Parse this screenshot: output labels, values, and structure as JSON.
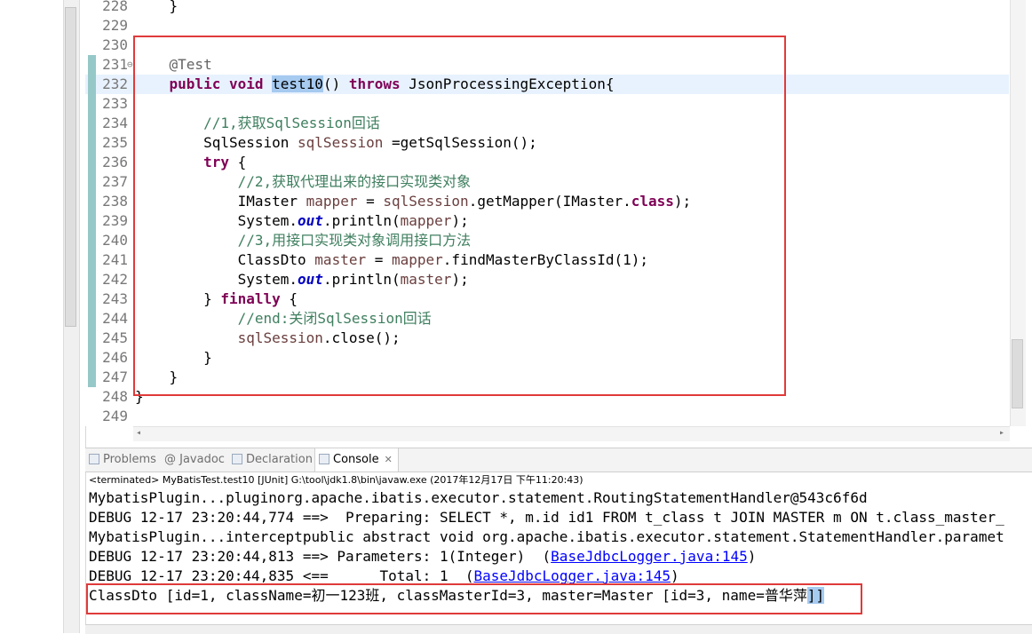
{
  "editor": {
    "lines": [
      {
        "num": "228",
        "segments": [
          {
            "t": "    }",
            "c": ""
          }
        ]
      },
      {
        "num": "229",
        "segments": []
      },
      {
        "num": "230",
        "segments": []
      },
      {
        "num": "231",
        "segments": [
          {
            "t": "    ",
            "c": ""
          },
          {
            "t": "@Test",
            "c": "ann"
          }
        ],
        "fold": "⊖"
      },
      {
        "num": "232",
        "current": true,
        "segments": [
          {
            "t": "    ",
            "c": ""
          },
          {
            "t": "public",
            "c": "kw"
          },
          {
            "t": " ",
            "c": ""
          },
          {
            "t": "void",
            "c": "kw"
          },
          {
            "t": " ",
            "c": ""
          },
          {
            "t": "test10",
            "c": "sel"
          },
          {
            "t": "() ",
            "c": ""
          },
          {
            "t": "throws",
            "c": "kw"
          },
          {
            "t": " JsonProcessingException{",
            "c": ""
          }
        ]
      },
      {
        "num": "233",
        "segments": []
      },
      {
        "num": "234",
        "segments": [
          {
            "t": "        ",
            "c": ""
          },
          {
            "t": "//1,获取SqlSession回话",
            "c": "cmt"
          }
        ]
      },
      {
        "num": "235",
        "segments": [
          {
            "t": "        SqlSession ",
            "c": ""
          },
          {
            "t": "sqlSession",
            "c": "var"
          },
          {
            "t": " =getSqlSession();",
            "c": ""
          }
        ]
      },
      {
        "num": "236",
        "segments": [
          {
            "t": "        ",
            "c": ""
          },
          {
            "t": "try",
            "c": "kw"
          },
          {
            "t": " {",
            "c": ""
          }
        ]
      },
      {
        "num": "237",
        "segments": [
          {
            "t": "            ",
            "c": ""
          },
          {
            "t": "//2,获取代理出来的接口实现类对象",
            "c": "cmt"
          }
        ]
      },
      {
        "num": "238",
        "segments": [
          {
            "t": "            IMaster ",
            "c": ""
          },
          {
            "t": "mapper",
            "c": "var"
          },
          {
            "t": " = ",
            "c": ""
          },
          {
            "t": "sqlSession",
            "c": "var"
          },
          {
            "t": ".getMapper(IMaster.",
            "c": ""
          },
          {
            "t": "class",
            "c": "kw"
          },
          {
            "t": ");",
            "c": ""
          }
        ]
      },
      {
        "num": "239",
        "segments": [
          {
            "t": "            System.",
            "c": ""
          },
          {
            "t": "out",
            "c": "fld"
          },
          {
            "t": ".println(",
            "c": ""
          },
          {
            "t": "mapper",
            "c": "var"
          },
          {
            "t": ");",
            "c": ""
          }
        ]
      },
      {
        "num": "240",
        "segments": [
          {
            "t": "            ",
            "c": ""
          },
          {
            "t": "//3,用接口实现类对象调用接口方法",
            "c": "cmt"
          }
        ]
      },
      {
        "num": "241",
        "segments": [
          {
            "t": "            ClassDto ",
            "c": ""
          },
          {
            "t": "master",
            "c": "var"
          },
          {
            "t": " = ",
            "c": ""
          },
          {
            "t": "mapper",
            "c": "var"
          },
          {
            "t": ".findMasterByClassId(1);",
            "c": ""
          }
        ]
      },
      {
        "num": "242",
        "segments": [
          {
            "t": "            System.",
            "c": ""
          },
          {
            "t": "out",
            "c": "fld"
          },
          {
            "t": ".println(",
            "c": ""
          },
          {
            "t": "master",
            "c": "var"
          },
          {
            "t": ");",
            "c": ""
          }
        ]
      },
      {
        "num": "243",
        "segments": [
          {
            "t": "        } ",
            "c": ""
          },
          {
            "t": "finally",
            "c": "kw"
          },
          {
            "t": " {",
            "c": ""
          }
        ]
      },
      {
        "num": "244",
        "segments": [
          {
            "t": "            ",
            "c": ""
          },
          {
            "t": "//end:关闭SqlSession回话",
            "c": "cmt"
          }
        ]
      },
      {
        "num": "245",
        "segments": [
          {
            "t": "            ",
            "c": ""
          },
          {
            "t": "sqlSession",
            "c": "var"
          },
          {
            "t": ".close();",
            "c": ""
          }
        ]
      },
      {
        "num": "246",
        "segments": [
          {
            "t": "        }",
            "c": ""
          }
        ]
      },
      {
        "num": "247",
        "segments": [
          {
            "t": "    }",
            "c": ""
          }
        ]
      },
      {
        "num": "248",
        "segments": [
          {
            "t": "}",
            "c": ""
          }
        ]
      },
      {
        "num": "249",
        "segments": []
      }
    ]
  },
  "tabs": [
    {
      "label": "Problems",
      "active": false
    },
    {
      "label": "@ Javadoc",
      "active": false
    },
    {
      "label": "Declaration",
      "active": false
    },
    {
      "label": "Console",
      "active": true
    }
  ],
  "console": {
    "status": "<terminated> MyBatisTest.test10 [JUnit] G:\\tool\\jdk1.8\\bin\\javaw.exe (2017年12月17日 下午11:20:43)",
    "lines": [
      {
        "segments": [
          {
            "t": "MybatisPlugin...pluginorg.apache.ibatis.executor.statement.RoutingStatementHandler@543c6f6d",
            "c": ""
          }
        ]
      },
      {
        "segments": [
          {
            "t": "DEBUG 12-17 23:20:44,774 ==>  Preparing: SELECT *, m.id id1 FROM t_class t JOIN MASTER m ON t.class_master_",
            "c": ""
          }
        ]
      },
      {
        "segments": [
          {
            "t": "MybatisPlugin...interceptpublic abstract void org.apache.ibatis.executor.statement.StatementHandler.paramet",
            "c": ""
          }
        ]
      },
      {
        "segments": [
          {
            "t": "DEBUG 12-17 23:20:44,813 ==> Parameters: 1(Integer)  (",
            "c": ""
          },
          {
            "t": "BaseJdbcLogger.java:145",
            "c": "link"
          },
          {
            "t": ")",
            "c": ""
          }
        ]
      },
      {
        "segments": [
          {
            "t": "DEBUG 12-17 23:20:44,835 <==      Total: 1  (",
            "c": ""
          },
          {
            "t": "BaseJdbcLogger.java:145",
            "c": "link"
          },
          {
            "t": ")",
            "c": ""
          }
        ]
      },
      {
        "segments": [
          {
            "t": "ClassDto [id=1, className=初一123班, classMasterId=3, master=Master [id=3, name=普华萍",
            "c": ""
          },
          {
            "t": "]]",
            "c": "sel"
          }
        ]
      }
    ]
  }
}
